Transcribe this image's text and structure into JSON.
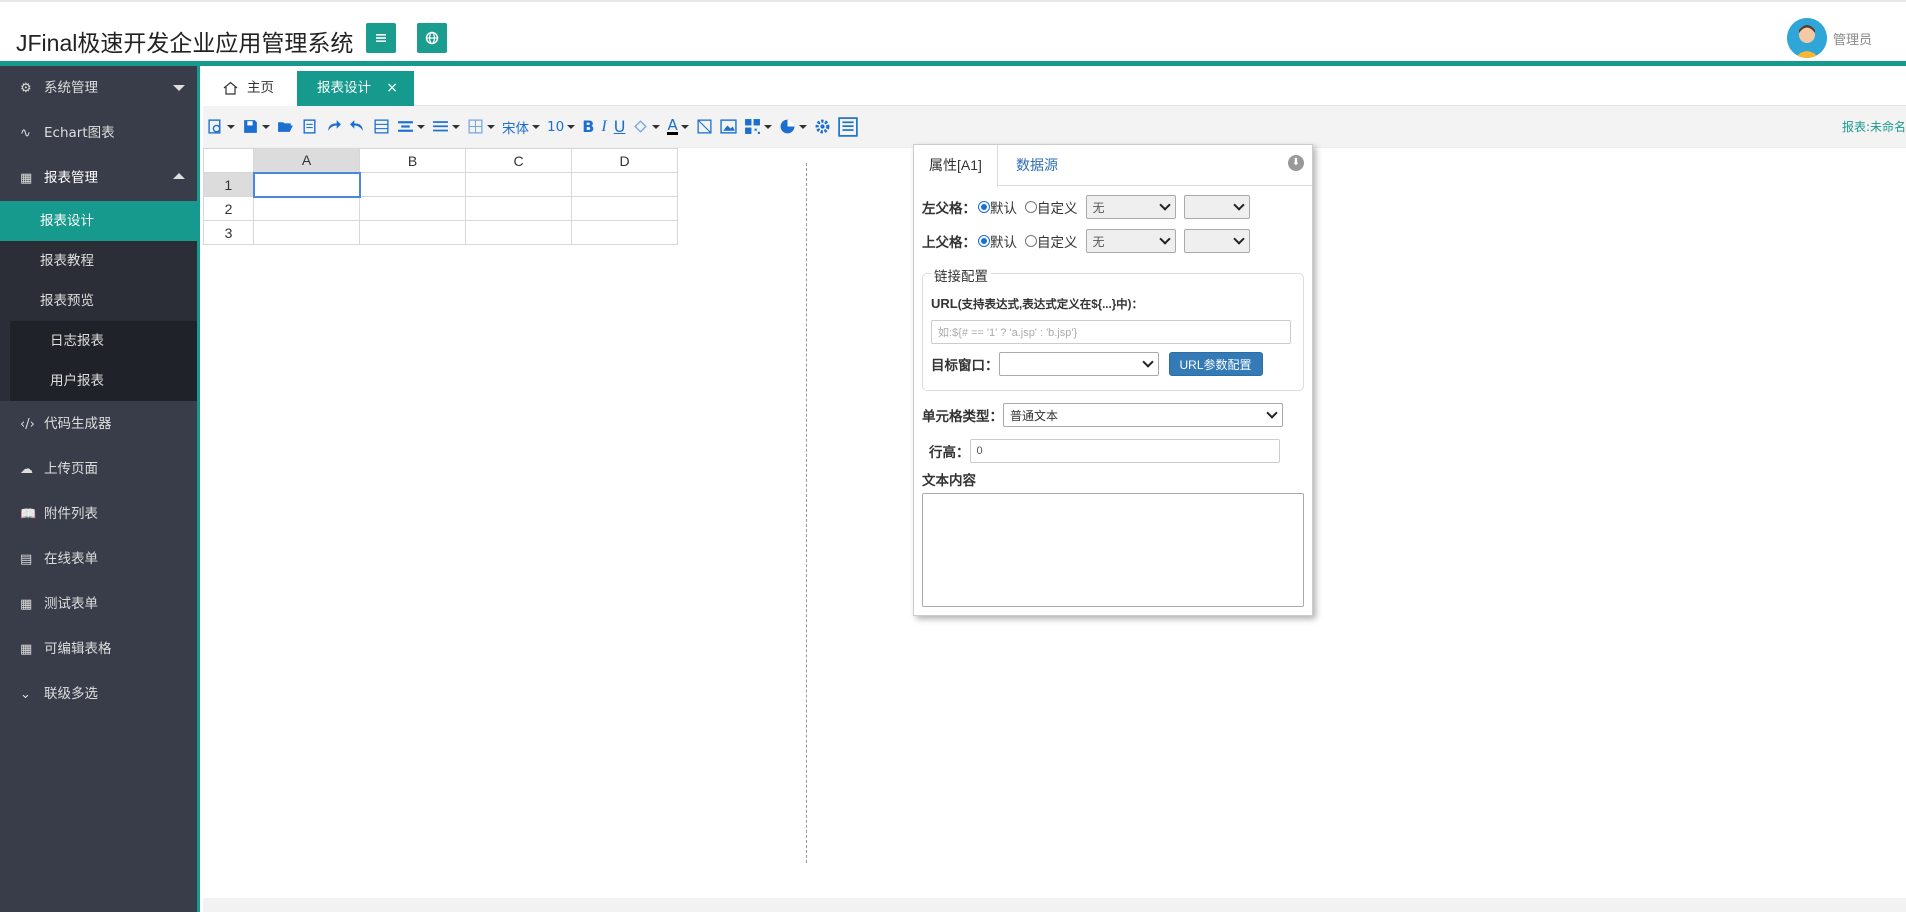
{
  "header": {
    "title": "JFinal极速开发企业应用管理系统",
    "user_name": "管理员",
    "accent_color": "#169a8d"
  },
  "sidebar": {
    "items": [
      {
        "label": "系统管理",
        "icon": "gear-icon"
      },
      {
        "label": "Echart图表",
        "icon": "chart-pulse-icon"
      },
      {
        "label": "报表管理",
        "icon": "report-icon"
      },
      {
        "label": "代码生成器",
        "icon": "code-icon"
      },
      {
        "label": "上传页面",
        "icon": "cloud-upload-icon"
      },
      {
        "label": "附件列表",
        "icon": "book-icon"
      },
      {
        "label": "在线表单",
        "icon": "form-icon"
      },
      {
        "label": "测试表单",
        "icon": "grid-icon"
      },
      {
        "label": "可编辑表格",
        "icon": "grid-icon"
      },
      {
        "label": "联级多选",
        "icon": "chevron-down-icon"
      }
    ],
    "report_sub": [
      "报表设计",
      "报表教程",
      "报表预览"
    ],
    "preview_sub": [
      "日志报表",
      "用户报表"
    ]
  },
  "tabs": {
    "home": "主页",
    "active": "报表设计",
    "close": "×"
  },
  "toolbar": {
    "font_family": "宋体",
    "font_size": "10",
    "bold": "B",
    "italic": "I",
    "underline": "U",
    "font_color": "A",
    "status": "报表:未命名"
  },
  "sheet": {
    "columns": [
      "A",
      "B",
      "C",
      "D"
    ],
    "rows": [
      "1",
      "2",
      "3"
    ]
  },
  "panel": {
    "tab_property": "属性[A1]",
    "tab_datasource": "数据源",
    "left_parent_label": "左父格：",
    "top_parent_label": "上父格：",
    "default_label": "默认",
    "custom_label": "自定义",
    "none_option": "无",
    "link_config": "链接配置",
    "url_label": "URL",
    "url_hint": "(支持表达式,表达式定义在${...}中)：",
    "url_placeholder": "如:${# == '1' ? 'a.jsp' : 'b.jsp'}",
    "target_window_label": "目标窗口：",
    "url_param_button": "URL参数配置",
    "cell_type_label": "单元格类型：",
    "cell_type_value": "普通文本",
    "row_height_label": "行高：",
    "row_height_value": "0",
    "text_content_label": "文本内容"
  }
}
